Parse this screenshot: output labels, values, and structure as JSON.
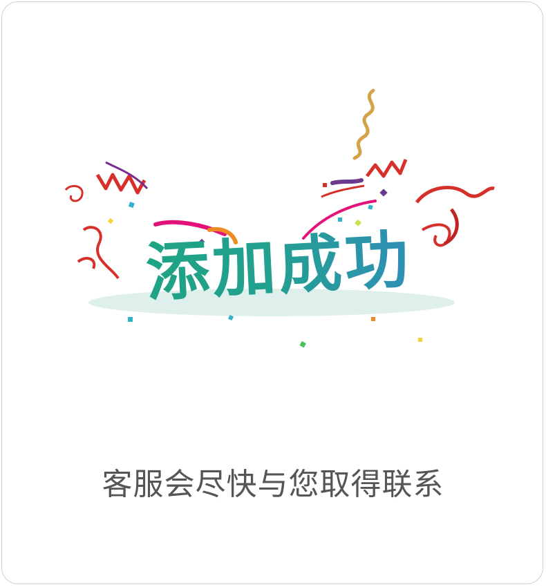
{
  "dialog": {
    "success_title": "添加成功",
    "message": "客服会尽快与您取得联系"
  },
  "illustration": {
    "name": "celebration-confetti-icon",
    "colors": {
      "title_start": "#1fa384",
      "title_end": "#2f8fb6",
      "ribbon_red": "#d6302b",
      "ribbon_pink": "#e2127a",
      "ribbon_gold": "#d4a348",
      "ribbon_purple": "#6a3a8f",
      "shadow": "#dff0ec"
    }
  }
}
